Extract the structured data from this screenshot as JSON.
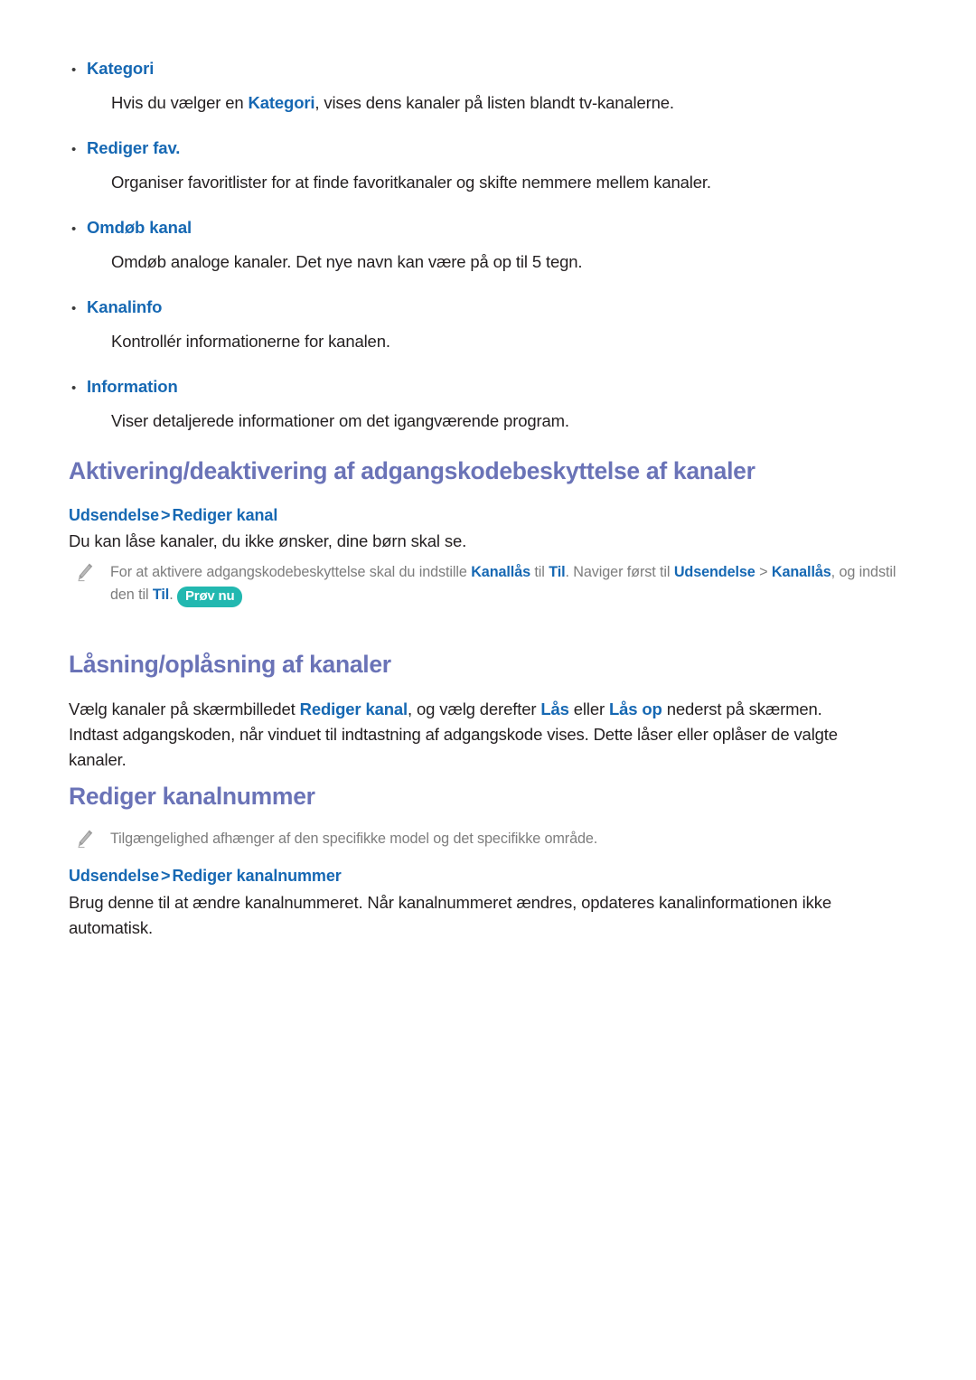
{
  "document": {
    "language": "da",
    "colors": {
      "heading": "#6a73b7",
      "link_blue": "#1668b3",
      "body_text": "#231f20",
      "note_text": "#7d7d7d",
      "try_now_badge": "#22b8b0",
      "page_background": "#ffffff"
    }
  },
  "bullet_list": {
    "items": [
      {
        "bullet": "•",
        "label": "Kategori",
        "description_pre": "Hvis du vælger en ",
        "description_link": "Kategori",
        "description_post": ", vises dens kanaler på listen blandt tv-kanalerne."
      },
      {
        "bullet": "•",
        "label": "Rediger fav.",
        "description_pre": "Organiser favoritlister for at finde favoritkanaler og skifte nemmere mellem kanaler.",
        "description_link": "",
        "description_post": ""
      },
      {
        "bullet": "•",
        "label": "Omdøb kanal",
        "description_pre": "Omdøb analoge kanaler. Det nye navn kan være på op til 5 tegn.",
        "description_link": "",
        "description_post": ""
      },
      {
        "bullet": "•",
        "label": "Kanalinfo",
        "description_pre": "Kontrollér informationerne for kanalen.",
        "description_link": "",
        "description_post": ""
      },
      {
        "bullet": "•",
        "label": "Information",
        "description_pre": "Viser detaljerede informationer om det igangværende program.",
        "description_link": "",
        "description_post": ""
      }
    ]
  },
  "sections": {
    "password_protection": {
      "title": "Aktivering/deaktivering af adgangskodebeskyttelse af kanaler",
      "breadcrumb": {
        "first": "Udsendelse",
        "separator": ">",
        "second": "Rediger kanal"
      },
      "paragraph": "Du kan låse kanaler, du ikke ønsker, dine børn skal se.",
      "note": {
        "icon": "pencil-icon",
        "t1": "For at aktivere adgangskodebeskyttelse skal du indstille ",
        "b1": "Kanallås",
        "t2": " til ",
        "b2": "Til",
        "t3": ". Naviger først til ",
        "b3": "Udsendelse",
        "t4": " > ",
        "b4": "Kanallås",
        "t5": ", og indstil den til ",
        "b5": "Til",
        "t6": ". ",
        "badge": "Prøv nu"
      }
    },
    "lock_unlock": {
      "title": "Låsning/oplåsning af kanaler",
      "paragraph": {
        "t1": "Vælg kanaler på skærmbilledet ",
        "b1": "Rediger kanal",
        "t2": ", og vælg derefter ",
        "b2": "Lås",
        "t3": " eller ",
        "b3": "Lås op",
        "t4": " nederst på skærmen. Indtast adgangskoden, når vinduet til indtastning af adgangskode vises. Dette låser eller oplåser de valgte kanaler."
      }
    },
    "edit_channel_number": {
      "title": "Rediger kanalnummer",
      "note": {
        "icon": "pencil-icon",
        "text": "Tilgængelighed afhænger af den specifikke model og det specifikke område."
      },
      "breadcrumb": {
        "first": "Udsendelse",
        "separator": ">",
        "second": "Rediger kanalnummer"
      },
      "paragraph": "Brug denne til at ændre kanalnummeret. Når kanalnummeret ændres, opdateres kanalinformationen ikke automatisk."
    }
  }
}
